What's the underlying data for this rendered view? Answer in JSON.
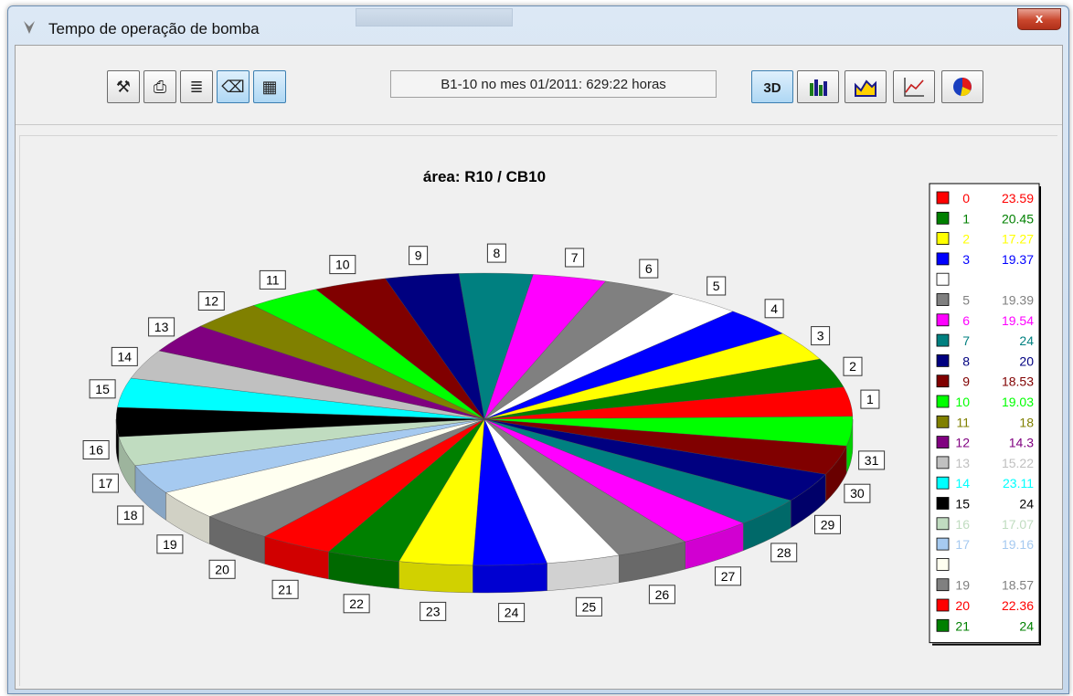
{
  "window": {
    "title": "Tempo de operação de bomba",
    "close_label": "x"
  },
  "toolbar": {
    "status_text": "B1-10 no mes 01/2011: 629:22 horas",
    "left_buttons": [
      {
        "icon": "wizard-icon",
        "glyph": "⚒"
      },
      {
        "icon": "printer-icon",
        "glyph": "⎙"
      },
      {
        "icon": "list-icon",
        "glyph": "≣"
      },
      {
        "icon": "eraser-icon",
        "glyph": "⌫"
      },
      {
        "icon": "export-icon",
        "glyph": "▦"
      }
    ],
    "chart_type_buttons": [
      {
        "icon": "3d-icon",
        "label": "3D"
      },
      {
        "icon": "bar-chart-icon",
        "label": ""
      },
      {
        "icon": "area-chart-icon",
        "label": ""
      },
      {
        "icon": "line-chart-icon",
        "label": ""
      },
      {
        "icon": "pie-chart-icon",
        "label": ""
      }
    ]
  },
  "colors": {
    "accent": "#3c7fb1",
    "background": "#f0f0f0"
  },
  "chart_data": {
    "type": "pie",
    "title": "área: R10 / CB10",
    "slices": [
      {
        "label": "8",
        "value": 24,
        "color": "#008080"
      },
      {
        "label": "7",
        "value": 24,
        "color": "#ff00ff"
      },
      {
        "label": "6",
        "value": 24,
        "color": "#808080"
      },
      {
        "label": "5",
        "value": 24,
        "color": "#ffffff"
      },
      {
        "label": "4",
        "value": 24,
        "color": "#0000ff"
      },
      {
        "label": "3",
        "value": 24,
        "color": "#ffff00"
      },
      {
        "label": "2",
        "value": 24,
        "color": "#008000"
      },
      {
        "label": "1",
        "value": 24,
        "color": "#ff0000"
      },
      {
        "label": "31",
        "value": 24,
        "color": "#00ff00"
      },
      {
        "label": "30",
        "value": 24,
        "color": "#800000"
      },
      {
        "label": "29",
        "value": 24,
        "color": "#000080"
      },
      {
        "label": "28",
        "value": 24,
        "color": "#008080"
      },
      {
        "label": "27",
        "value": 24,
        "color": "#ff00ff"
      },
      {
        "label": "26",
        "value": 24,
        "color": "#808080"
      },
      {
        "label": "25",
        "value": 24,
        "color": "#ffffff"
      },
      {
        "label": "24",
        "value": 24,
        "color": "#0000ff"
      },
      {
        "label": "23",
        "value": 24,
        "color": "#ffff00"
      },
      {
        "label": "22",
        "value": 24,
        "color": "#008000"
      },
      {
        "label": "21",
        "value": 24,
        "color": "#ff0000"
      },
      {
        "label": "20",
        "value": 24,
        "color": "#808080"
      },
      {
        "label": "19",
        "value": 24,
        "color": "#fffff0"
      },
      {
        "label": "18",
        "value": 24,
        "color": "#a6caf0"
      },
      {
        "label": "17",
        "value": 24,
        "color": "#c0dcc0"
      },
      {
        "label": "16",
        "value": 24,
        "color": "#000000"
      },
      {
        "label": "15",
        "value": 24,
        "color": "#00ffff"
      },
      {
        "label": "14",
        "value": 24,
        "color": "#c0c0c0"
      },
      {
        "label": "13",
        "value": 24,
        "color": "#800080"
      },
      {
        "label": "12",
        "value": 24,
        "color": "#808000"
      },
      {
        "label": "11",
        "value": 24,
        "color": "#00ff00"
      },
      {
        "label": "10",
        "value": 24,
        "color": "#800000"
      },
      {
        "label": "9",
        "value": 24,
        "color": "#000080"
      }
    ],
    "legend_position": "right",
    "legend": [
      {
        "index": "0",
        "value": "23.59",
        "color": "#ff0000"
      },
      {
        "index": "1",
        "value": "20.45",
        "color": "#008000"
      },
      {
        "index": "2",
        "value": "17.27",
        "color": "#ffff00"
      },
      {
        "index": "3",
        "value": "19.37",
        "color": "#0000ff"
      },
      {
        "index": "",
        "value": "",
        "color": "#ffffff"
      },
      {
        "index": "5",
        "value": "19.39",
        "color": "#808080"
      },
      {
        "index": "6",
        "value": "19.54",
        "color": "#ff00ff"
      },
      {
        "index": "7",
        "value": "24",
        "color": "#008080"
      },
      {
        "index": "8",
        "value": "20",
        "color": "#000080"
      },
      {
        "index": "9",
        "value": "18.53",
        "color": "#800000"
      },
      {
        "index": "10",
        "value": "19.03",
        "color": "#00ff00"
      },
      {
        "index": "11",
        "value": "18",
        "color": "#808000"
      },
      {
        "index": "12",
        "value": "14.3",
        "color": "#800080"
      },
      {
        "index": "13",
        "value": "15.22",
        "color": "#c0c0c0"
      },
      {
        "index": "14",
        "value": "23.11",
        "color": "#00ffff"
      },
      {
        "index": "15",
        "value": "24",
        "color": "#000000"
      },
      {
        "index": "16",
        "value": "17.07",
        "color": "#c0dcc0"
      },
      {
        "index": "17",
        "value": "19.16",
        "color": "#a6caf0"
      },
      {
        "index": "",
        "value": "",
        "color": "#fffff0"
      },
      {
        "index": "19",
        "value": "18.57",
        "color": "#808080"
      },
      {
        "index": "20",
        "value": "22.36",
        "color": "#ff0000"
      },
      {
        "index": "21",
        "value": "24",
        "color": "#008000"
      }
    ]
  }
}
